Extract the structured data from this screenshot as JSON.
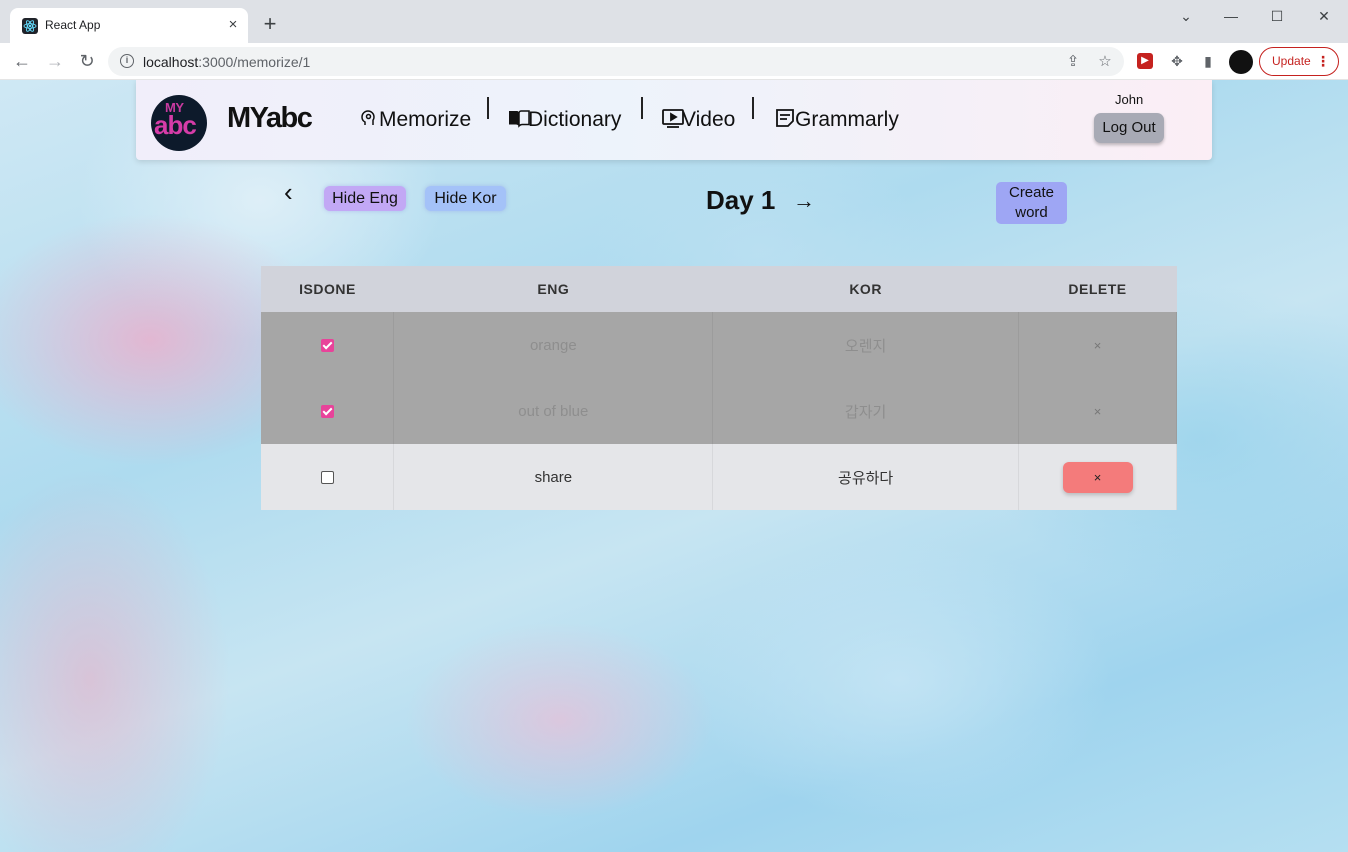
{
  "browser": {
    "tab_title": "React App",
    "tab_close": "×",
    "new_tab": "+",
    "url_host": "localhost",
    "url_path": ":3000/memorize/1",
    "update_label": "Update",
    "minimize": "—",
    "maximize": "☐",
    "close": "✕",
    "tab_search": "⌄"
  },
  "navbar": {
    "brand": "MYabc",
    "logo_my": "MY",
    "logo_abc": "abc",
    "links": [
      {
        "label": "Memorize",
        "icon": "brain-icon"
      },
      {
        "label": "Dictionary",
        "icon": "book-icon"
      },
      {
        "label": "Video",
        "icon": "video-icon"
      },
      {
        "label": "Grammarly",
        "icon": "note-icon"
      }
    ],
    "user_name": "John",
    "logout_label": "Log Out"
  },
  "controls": {
    "hide_eng": "Hide Eng",
    "hide_kor": "Hide Kor",
    "day_title": "Day 1",
    "create_word_line1": "Create",
    "create_word_line2": "word"
  },
  "table": {
    "headers": [
      "ISDONE",
      "ENG",
      "KOR",
      "DELETE"
    ],
    "rows": [
      {
        "done": true,
        "eng": "orange",
        "kor": "오렌지",
        "delete": "×"
      },
      {
        "done": true,
        "eng": "out of blue",
        "kor": "갑자기",
        "delete": "×"
      },
      {
        "done": false,
        "eng": "share",
        "kor": "공유하다",
        "delete": "×"
      }
    ]
  },
  "colors": {
    "done_row": "#a6a6a6",
    "open_row": "#e5e6e9",
    "delete_button": "#f47b7b",
    "checkbox_checked": "#e8439a",
    "hide_eng_button": "#c2a8f5",
    "hide_kor_button": "#a4c2f8",
    "create_button": "#9ea6f4"
  }
}
